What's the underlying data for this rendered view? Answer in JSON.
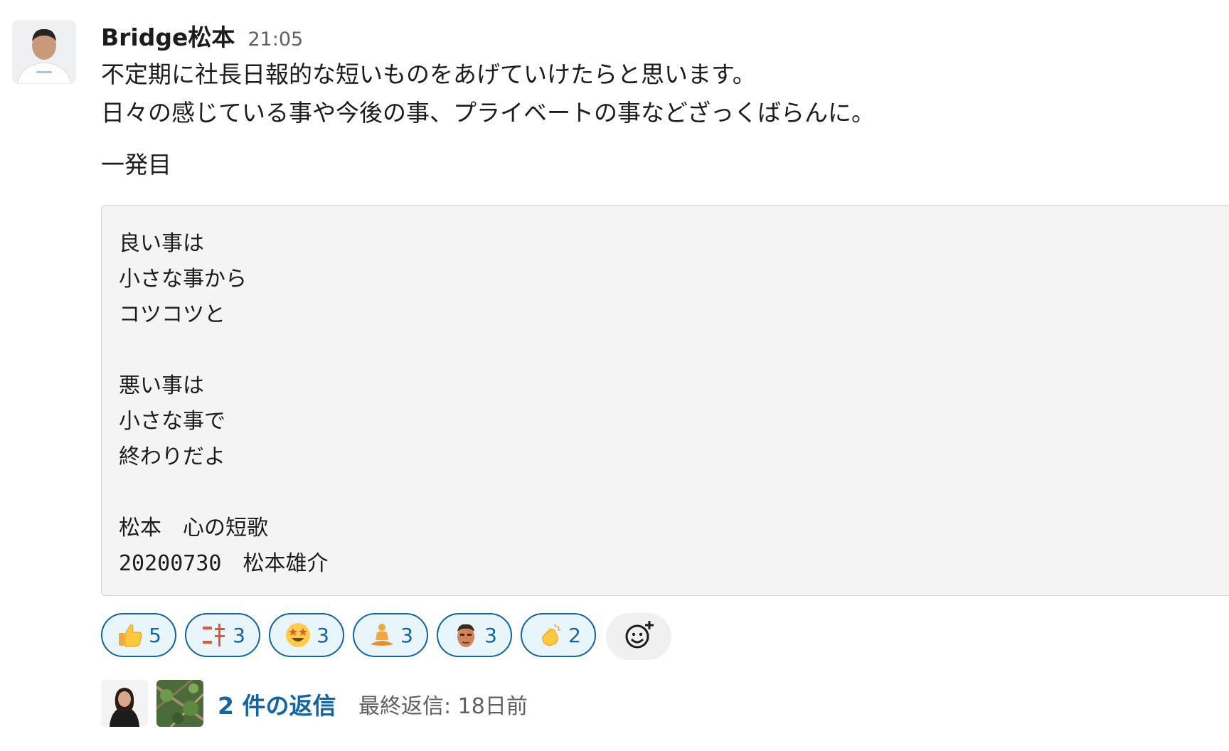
{
  "message": {
    "author": "Bridge松本",
    "time": "21:05",
    "lines": [
      "不定期に社長日報的な短いものをあげていけたらと思います。",
      "日々の感じている事や今後の事、プライベートの事などざっくばらんに。"
    ],
    "heading": "一発目",
    "quote_lines": [
      "良い事は",
      "小さな事から",
      "コツコツと",
      "",
      "悪い事は",
      "小さな事で",
      "終わりだよ",
      "",
      "松本　心の短歌",
      "20200730　松本雄介"
    ]
  },
  "reactions": [
    {
      "icon": "thumbs-up-icon",
      "count": "5"
    },
    {
      "icon": "kanji-stamp-icon",
      "count": "3"
    },
    {
      "icon": "star-struck-face-icon",
      "count": "3"
    },
    {
      "icon": "person-meditating-icon",
      "count": "3"
    },
    {
      "icon": "custom-face-icon",
      "count": "3"
    },
    {
      "icon": "clapping-hands-icon",
      "count": "2"
    }
  ],
  "thread": {
    "reply_count": "2 件の返信",
    "last_reply": "最終返信: 18日前"
  },
  "colors": {
    "accent": "#1264a3",
    "reaction_bg": "#e8f5fa",
    "quote_bg": "#f4f4f4",
    "muted_text": "#616061"
  }
}
